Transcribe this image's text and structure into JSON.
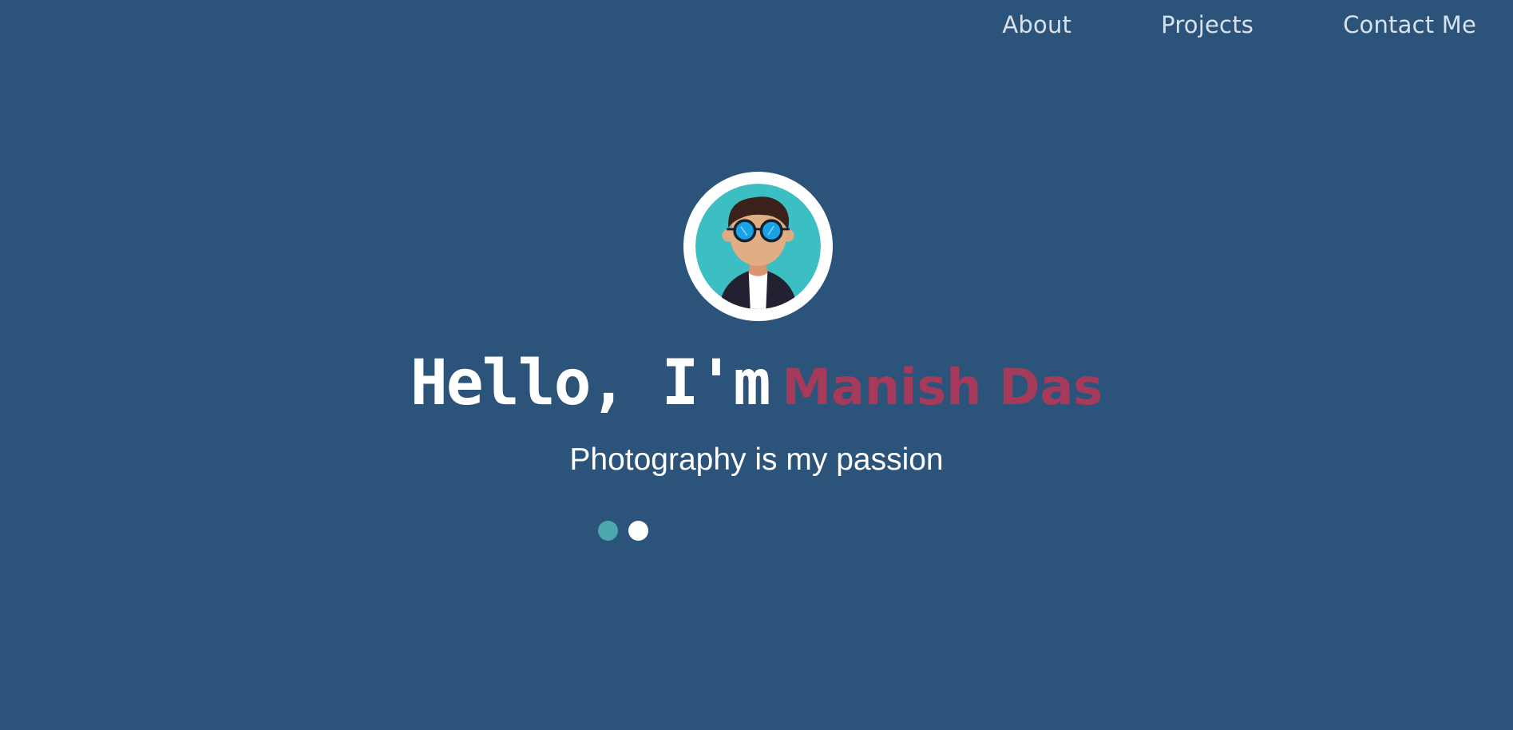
{
  "nav": {
    "items": [
      {
        "label": "About"
      },
      {
        "label": "Projects"
      },
      {
        "label": "Contact Me"
      }
    ]
  },
  "hero": {
    "greeting": "Hello, I'm",
    "name": "Manish Das",
    "tagline": "Photography is my passion"
  },
  "carousel": {
    "dots": [
      {
        "color": "#4aa8ae",
        "active": true
      },
      {
        "color": "#ffffff",
        "active": false
      }
    ]
  },
  "colors": {
    "background": "#2c5379",
    "accent_name": "#a53a5a",
    "avatar_bg": "#3bbfc2"
  }
}
